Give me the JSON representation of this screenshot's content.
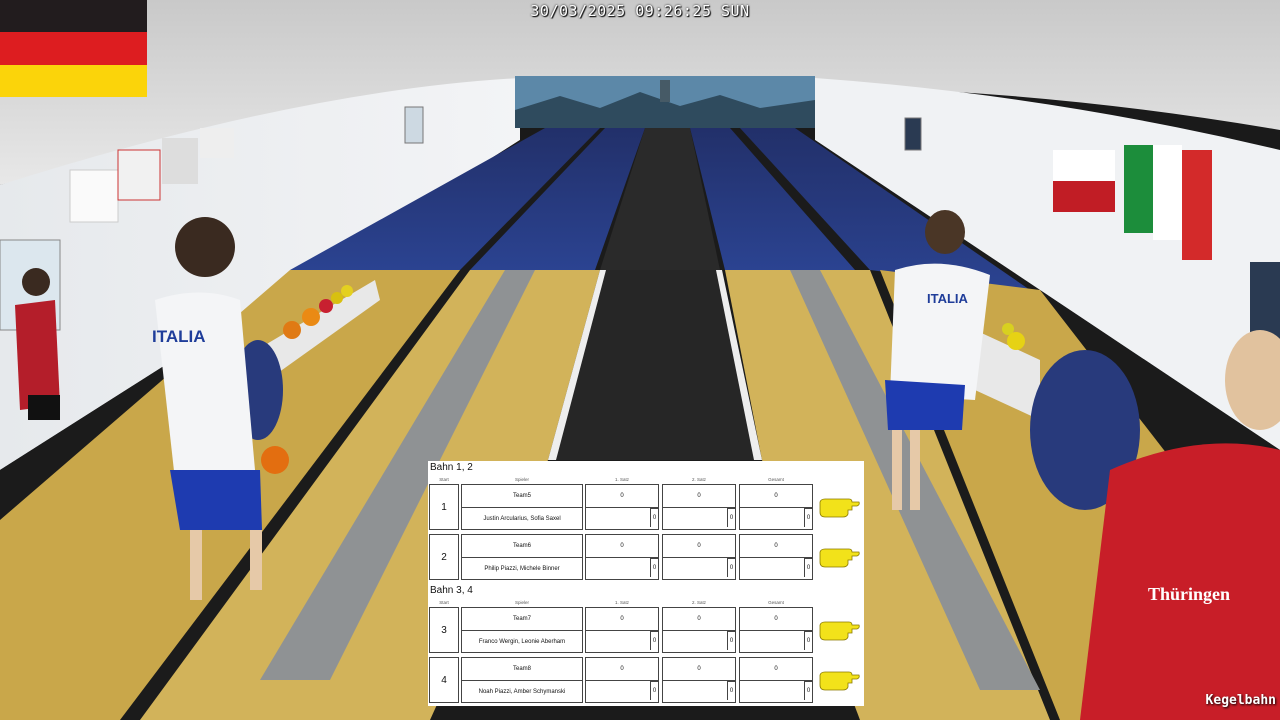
{
  "overlay": {
    "timestamp": "30/03/2025 09:26:25 SUN",
    "watermark": "Kegelbahn",
    "flag_colors": [
      "#221c1e",
      "#dd1d20",
      "#fbd40a"
    ]
  },
  "scene": {
    "jersey_text": "ITALIA",
    "right_jersey_text": "Thüringen"
  },
  "scoreboard": {
    "columns": [
      "Start",
      "Spieler",
      "1. Satz",
      "2. Satz",
      "Gesamt"
    ],
    "sections": [
      {
        "title": "Bahn 1, 2",
        "rows": [
          {
            "rank": "1",
            "team": "Team5",
            "players": "Justin Arcularius, Sofia Saxel",
            "set1": "0",
            "set1_sub": "0",
            "set2": "0",
            "set2_sub": "0",
            "total": "0",
            "total_sub": "0"
          },
          {
            "rank": "2",
            "team": "Team6",
            "players": "Philip Piazzi, Michele Binner",
            "set1": "0",
            "set1_sub": "0",
            "set2": "0",
            "set2_sub": "0",
            "total": "0",
            "total_sub": "0"
          }
        ]
      },
      {
        "title": "Bahn 3, 4",
        "rows": [
          {
            "rank": "3",
            "team": "Team7",
            "players": "Franco Wergin, Leonie Aberham",
            "set1": "0",
            "set1_sub": "0",
            "set2": "0",
            "set2_sub": "0",
            "total": "0",
            "total_sub": "0"
          },
          {
            "rank": "4",
            "team": "Team8",
            "players": "Noah Piazzi, Amber Schymanski",
            "set1": "0",
            "set1_sub": "0",
            "set2": "0",
            "set2_sub": "0",
            "total": "0",
            "total_sub": "0"
          }
        ]
      }
    ]
  }
}
